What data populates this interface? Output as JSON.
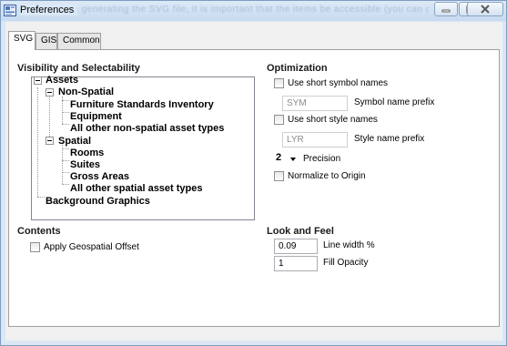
{
  "window": {
    "title": "Preferences",
    "ghost_text": "efore generating the SVG file, it is important that the items be accessible (you can click or"
  },
  "tabs": [
    {
      "label": "SVG",
      "active": true
    },
    {
      "label": "GIS",
      "active": false
    },
    {
      "label": "Common",
      "active": false
    }
  ],
  "visibility": {
    "title": "Visibility and Selectability",
    "tree": {
      "assets": "Assets",
      "non_spatial": "Non-Spatial",
      "furniture": "Furniture Standards Inventory",
      "equipment": "Equipment",
      "other_non_spatial": "All other non-spatial asset types",
      "spatial": "Spatial",
      "rooms": "Rooms",
      "suites": "Suites",
      "gross_areas": "Gross Areas",
      "other_spatial": "All other spatial asset types",
      "background": "Background Graphics"
    }
  },
  "contents": {
    "title": "Contents",
    "apply_offset_label": "Apply Geospatial Offset",
    "apply_offset_checked": false
  },
  "optimization": {
    "title": "Optimization",
    "short_symbol_label": "Use short symbol names",
    "short_symbol_checked": false,
    "symbol_prefix_value": "SYM",
    "symbol_prefix_label": "Symbol name prefix",
    "short_style_label": "Use short style names",
    "short_style_checked": false,
    "style_prefix_value": "LYR",
    "style_prefix_label": "Style name prefix",
    "precision_value": "2",
    "precision_label": "Precision",
    "normalize_label": "Normalize to Origin",
    "normalize_checked": false
  },
  "look_and_feel": {
    "title": "Look and Feel",
    "line_width_value": "0.09",
    "line_width_label": "Line width %",
    "fill_opacity_value": "1",
    "fill_opacity_label": "Fill Opacity"
  },
  "colors": {
    "titlebar": "#c8daef",
    "close_icon": "#5a5a5a"
  }
}
